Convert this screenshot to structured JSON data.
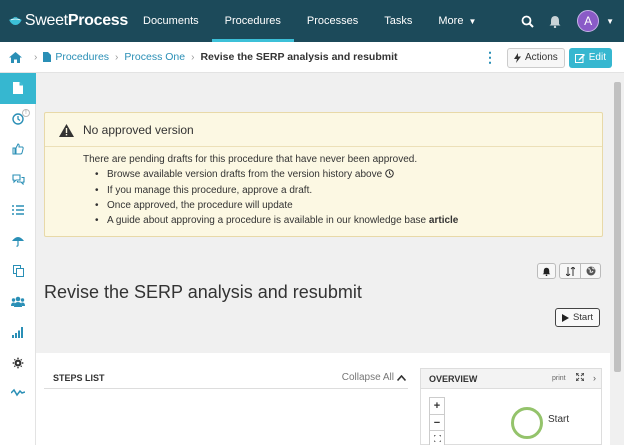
{
  "app": {
    "logo_light": "Sweet",
    "logo_bold": "Process",
    "nav": [
      "Documents",
      "Procedures",
      "Processes",
      "Tasks",
      "More"
    ],
    "user_initial": "A",
    "colors": {
      "nav_bg": "#1c4a5a",
      "accent": "#36b7d0",
      "avatar": "#8a5bc7",
      "warning_bg": "#fcf8e3",
      "node_green": "#94c36b"
    }
  },
  "breadcrumb": {
    "items": [
      "Procedures",
      "Process One"
    ],
    "current": "Revise the SERP analysis and resubmit",
    "actions_label": "Actions",
    "edit_label": "Edit"
  },
  "sidebar": {
    "icons": [
      "document-icon",
      "history-icon",
      "thumbs-up-icon",
      "comments-icon",
      "tasks-icon",
      "umbrella-icon",
      "copy-icon",
      "users-icon",
      "signal-icon",
      "gear-icon",
      "analytics-icon"
    ],
    "badge": "!"
  },
  "alert": {
    "title": "No approved version",
    "intro": "There are pending drafts for this procedure that have never been approved.",
    "bullets": [
      "Browse available version drafts from the version history above",
      "If you manage this procedure, approve a draft.",
      "Once approved, the procedure will update",
      "A guide about approving a procedure is available in our knowledge base"
    ],
    "link": "article"
  },
  "procedure": {
    "title": "Revise the SERP analysis and resubmit",
    "start_label": "Start"
  },
  "steps": {
    "title": "STEPS LIST",
    "collapse_label": "Collapse All"
  },
  "overview": {
    "title": "OVERVIEW",
    "print_label": "print",
    "zoom_in": "+",
    "zoom_out": "−",
    "node_label": "Start"
  }
}
